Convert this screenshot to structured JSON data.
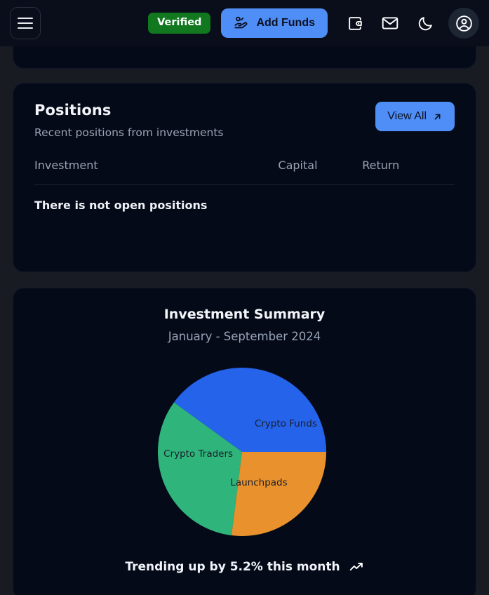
{
  "header": {
    "menu_icon": "hamburger-menu-icon",
    "verified_badge": "Verified",
    "add_funds_label": "Add Funds",
    "add_funds_icon": "hand-coins-icon",
    "wallet_icon": "wallet-icon",
    "mail_icon": "mail-icon",
    "dark_mode_icon": "moon-icon",
    "avatar_icon": "user-circle-icon",
    "colors": {
      "accent": "#4f8ef7",
      "verified": "#11781f",
      "background": "#0a0e1a"
    }
  },
  "positions": {
    "title": "Positions",
    "subtitle": "Recent positions from investments",
    "view_all_label": "View All",
    "view_all_icon": "arrow-up-right-icon",
    "columns": [
      "Investment",
      "Capital",
      "Return"
    ],
    "empty_message": "There is not open positions"
  },
  "summary": {
    "title": "Investment Summary",
    "subtitle": "January - September 2024",
    "trend_text": "Trending up by 5.2% this month",
    "trend_icon": "trending-up-icon"
  },
  "chart_data": {
    "type": "pie",
    "title": "Investment Summary",
    "subtitle": "January - September 2024",
    "categories": [
      "Crypto Funds",
      "Crypto Traders",
      "Launchpads"
    ],
    "values": [
      40,
      33,
      27
    ],
    "colors": [
      "#2563eb",
      "#2fb47c",
      "#e8912d"
    ],
    "labels_inside": true,
    "legend": "none",
    "start_angle_deg": 0,
    "direction": "counterclockwise",
    "annotation": "Trending up by 5.2% this month"
  }
}
